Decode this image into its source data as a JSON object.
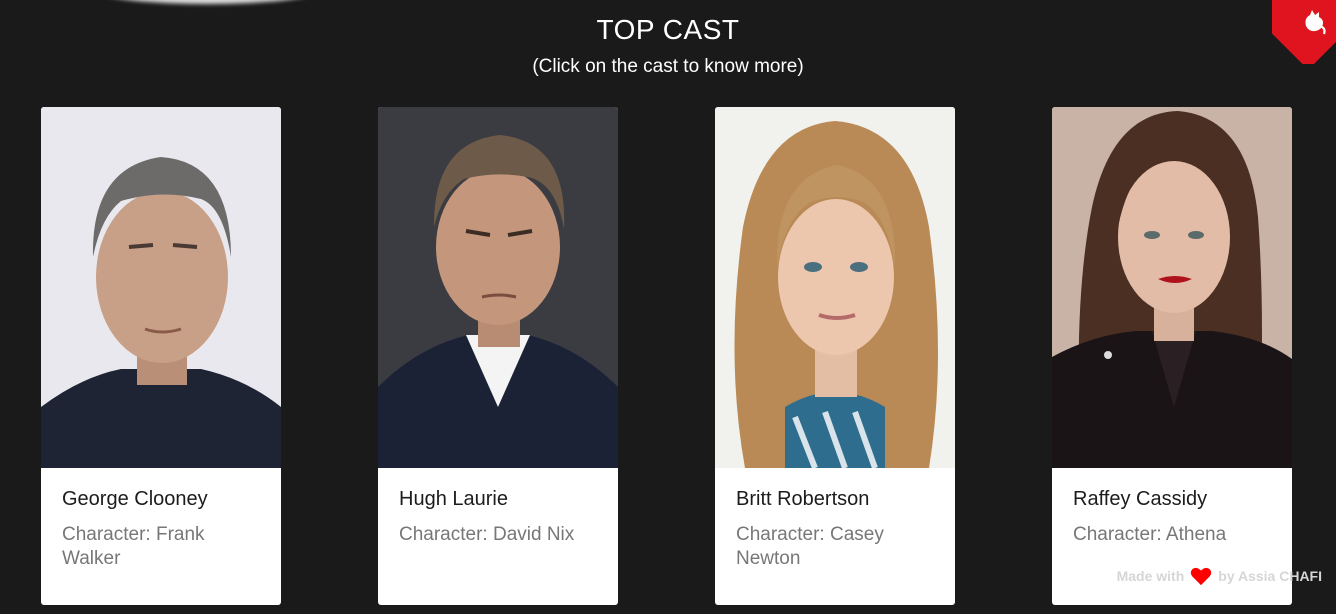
{
  "header": {
    "title": "TOP CAST",
    "subtitle": "(Click on the cast to know more)"
  },
  "cast": [
    {
      "name": "George Clooney",
      "character": "Character: Frank Walker"
    },
    {
      "name": "Hugh Laurie",
      "character": "Character: David Nix"
    },
    {
      "name": "Britt Robertson",
      "character": "Character: Casey Newton"
    },
    {
      "name": "Raffey Cassidy",
      "character": "Character: Athena"
    }
  ],
  "footer": {
    "made_with": "Made with",
    "by": "by Assia CHAFI",
    "heart_icon": "heart-icon",
    "heart_color": "#ff0000"
  },
  "corner": {
    "icon": "github-cat-icon",
    "color": "#e0141e"
  }
}
